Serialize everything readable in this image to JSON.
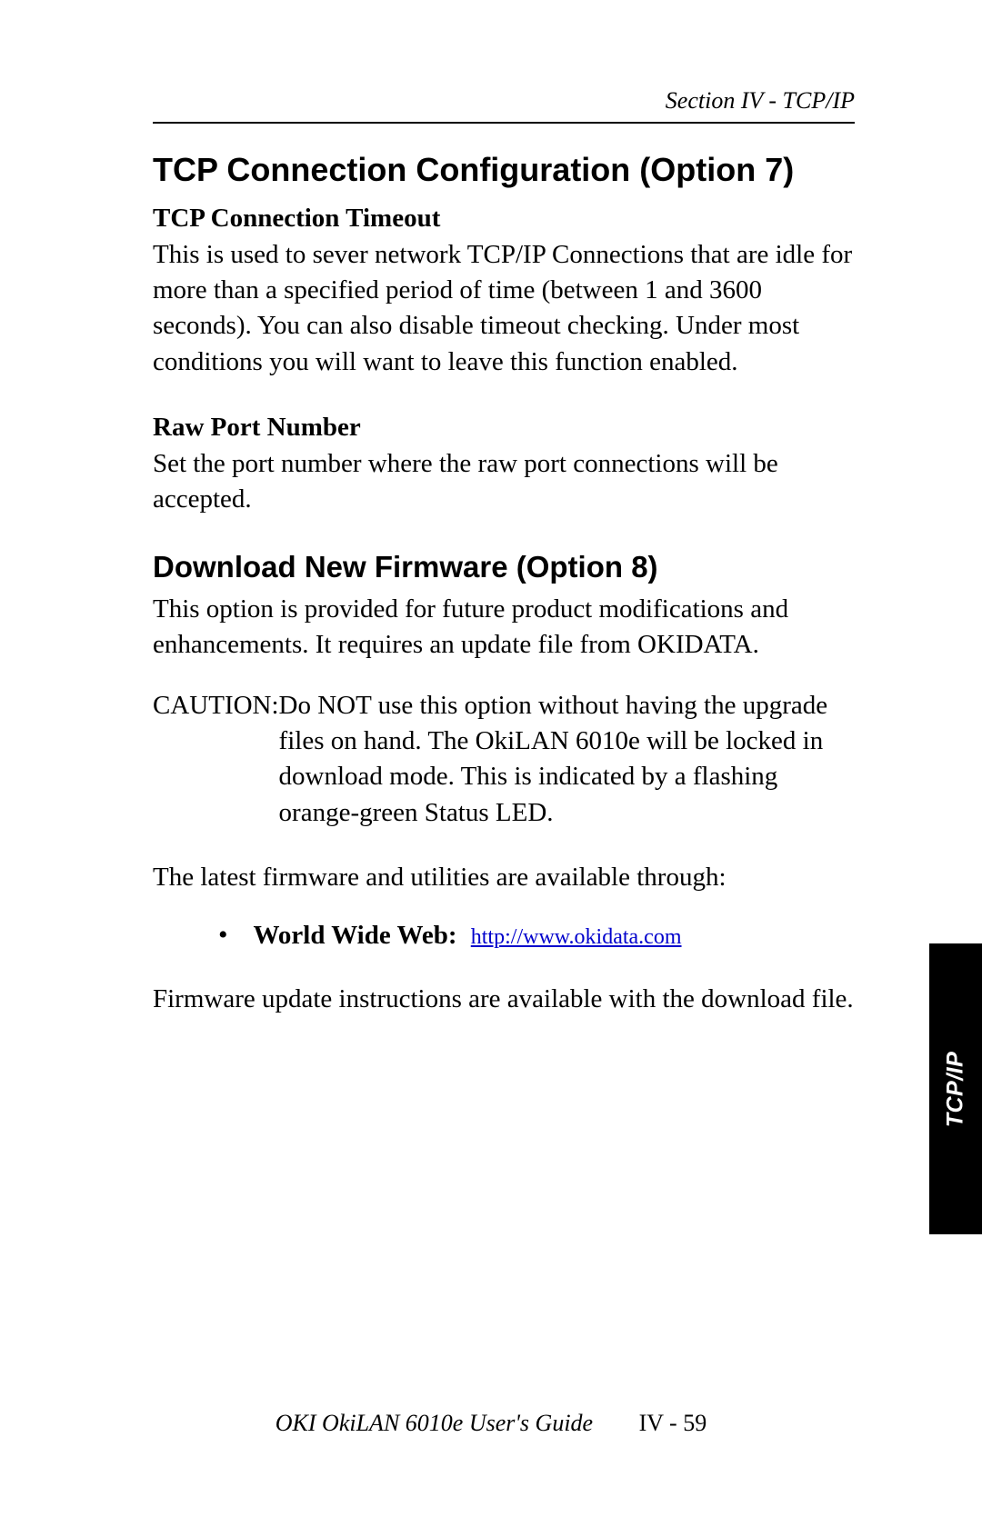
{
  "header": {
    "section_label": "Section IV - TCP/IP"
  },
  "content": {
    "h1": "TCP Connection Configuration (Option 7)",
    "sub1_title": "TCP Connection Timeout",
    "sub1_body": "This is used to sever network TCP/IP Connections that are idle for more than a specified period of time (between 1 and 3600 seconds). You can also disable timeout checking. Under most conditions you will want to leave this function enabled.",
    "sub2_title": "Raw Port Number",
    "sub2_body": "Set the port number where the raw port connections will be accepted.",
    "h2": "Download New Firmware (Option 8)",
    "h2_body1": "This option is provided for future product modifications and enhancements. It requires an update file from OKIDATA.",
    "caution_label": "CAUTION: ",
    "caution_body": "Do NOT use this option without having the upgrade files on hand. The OkiLAN 6010e will be locked in download mode. This is indicated by a flashing orange-green Status LED.",
    "available_text": "The latest firmware and utilities are available through:",
    "bullet_label": "World Wide Web:",
    "bullet_link_text": "http://www.okidata.com",
    "closing": "Firmware update instructions are available with the download file."
  },
  "side_tab": "TCP/IP",
  "footer": {
    "guide": "OKI OkiLAN 6010e User's Guide",
    "page": "IV - 59"
  }
}
